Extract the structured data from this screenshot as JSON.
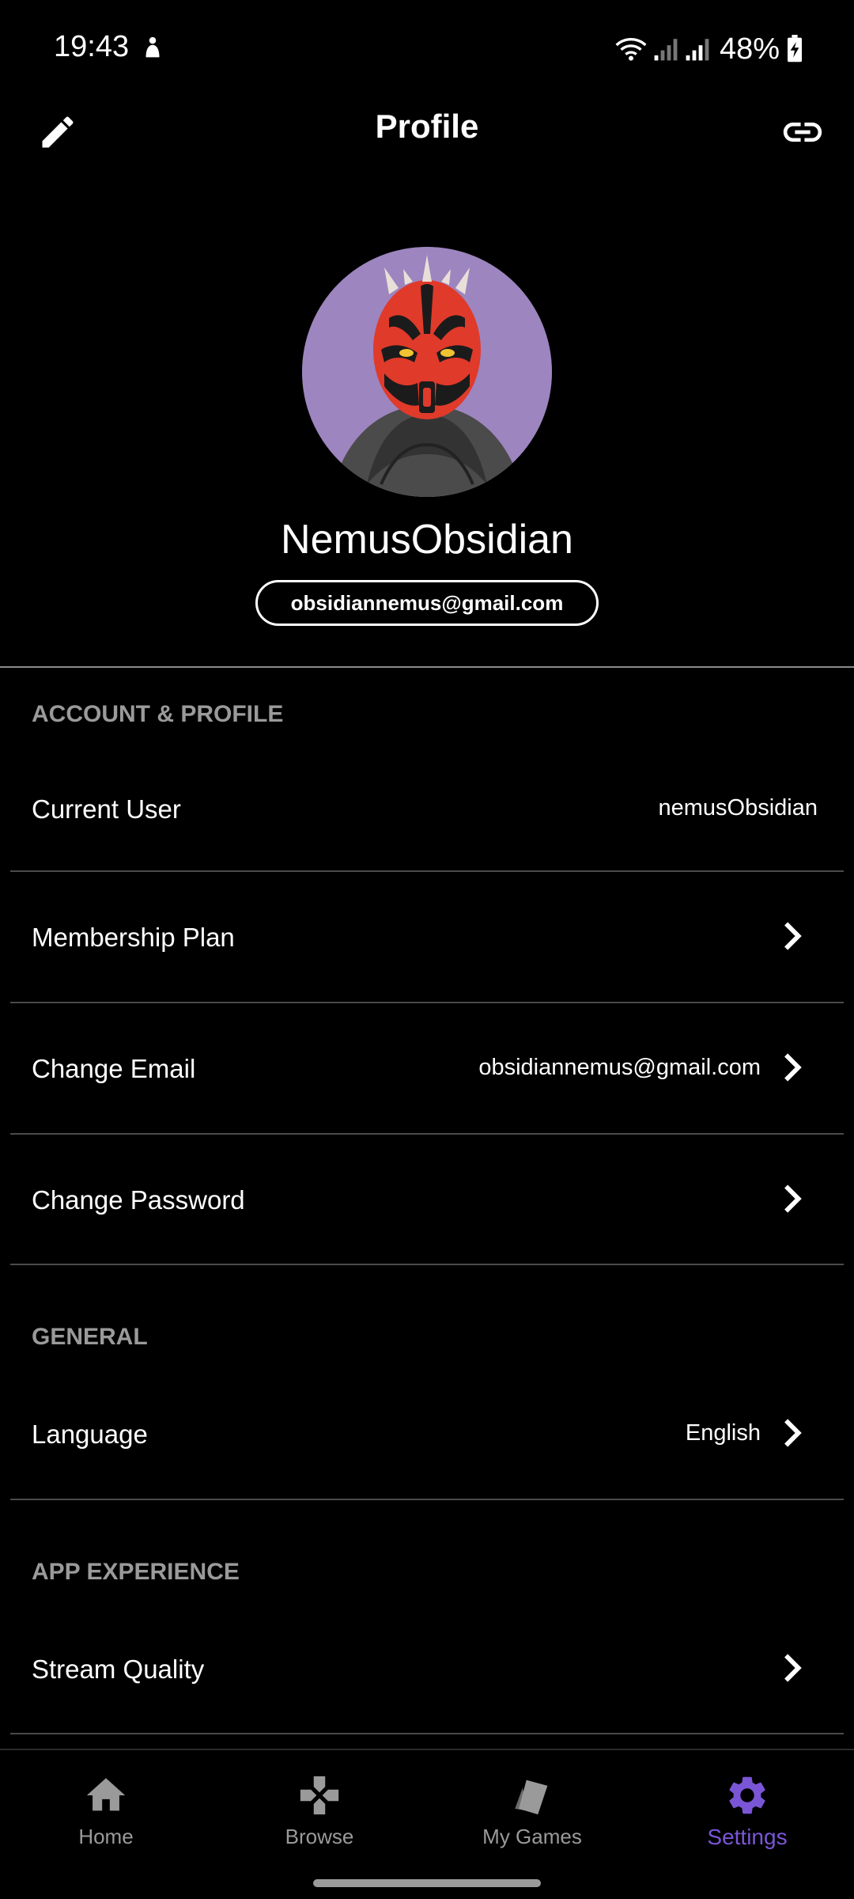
{
  "status_bar": {
    "time": "19:43",
    "battery": "48%",
    "icons": [
      "dnd-icon",
      "wifi-icon",
      "signal-icon",
      "signal-icon",
      "battery-charging-icon"
    ]
  },
  "app_bar": {
    "title": "Profile",
    "left_icon": "edit-icon",
    "right_icon": "link-icon"
  },
  "profile": {
    "name": "NemusObsidian",
    "email": "obsidiannemus@gmail.com"
  },
  "sections": {
    "account": {
      "heading": "ACCOUNT & PROFILE",
      "current_user": {
        "label": "Current User",
        "value": "nemusObsidian"
      },
      "membership": {
        "label": "Membership Plan"
      },
      "change_email": {
        "label": "Change Email",
        "value": "obsidiannemus@gmail.com"
      },
      "change_password": {
        "label": "Change Password"
      }
    },
    "general": {
      "heading": "GENERAL",
      "language": {
        "label": "Language",
        "value": "English"
      }
    },
    "app_experience": {
      "heading": "APP EXPERIENCE",
      "stream_quality": {
        "label": "Stream Quality"
      }
    }
  },
  "bottom_nav": {
    "items": [
      {
        "label": "Home",
        "icon": "home-icon"
      },
      {
        "label": "Browse",
        "icon": "gamepad-icon"
      },
      {
        "label": "My Games",
        "icon": "cards-icon"
      },
      {
        "label": "Settings",
        "icon": "gear-icon",
        "active": true
      }
    ]
  },
  "colors": {
    "background": "#000000",
    "accent": "#7a56d6",
    "muted_text": "#9a9a9a",
    "avatar_bg": "#9d85bf"
  }
}
